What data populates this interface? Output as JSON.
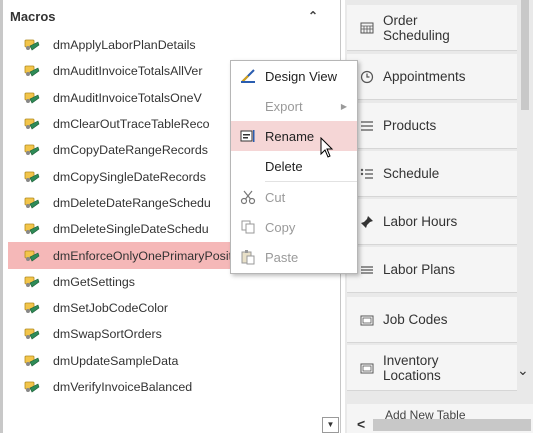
{
  "nav": {
    "header": "Macros",
    "macros": [
      "dmApplyLaborPlanDetails",
      "dmAuditInvoiceTotalsAllVer",
      "dmAuditInvoiceTotalsOneV",
      "dmClearOutTraceTableReco",
      "dmCopyDateRangeRecords",
      "dmCopySingleDateRecords",
      "dmDeleteDateRangeSchedu",
      "dmDeleteSingleDateSchedu",
      "dmEnforceOnlyOnePrimaryPosition",
      "dmGetSettings",
      "dmSetJobCodeColor",
      "dmSwapSortOrders",
      "dmUpdateSampleData",
      "dmVerifyInvoiceBalanced"
    ],
    "selected_index": 8
  },
  "context_menu": {
    "items": [
      {
        "label": "Design View",
        "icon": "design-view-icon",
        "enabled": true
      },
      {
        "label": "Export",
        "icon": "",
        "enabled": false,
        "submenu": true
      },
      {
        "label": "Rename",
        "icon": "rename-icon",
        "enabled": true,
        "hovered": true
      },
      {
        "label": "Delete",
        "icon": "",
        "enabled": true
      },
      {
        "label": "Cut",
        "icon": "scissors-icon",
        "enabled": false
      },
      {
        "label": "Copy",
        "icon": "copy-icon",
        "enabled": false
      },
      {
        "label": "Paste",
        "icon": "paste-icon",
        "enabled": false
      }
    ]
  },
  "right_pane": {
    "buttons": [
      {
        "label": "Order Scheduling",
        "icon": "calendar-grid-icon"
      },
      {
        "label": "Appointments",
        "icon": "clock-icon"
      },
      {
        "label": "Products",
        "icon": "list-icon"
      },
      {
        "label": "Schedule",
        "icon": "schedule-list-icon"
      },
      {
        "label": "Labor Hours",
        "icon": "pin-icon"
      },
      {
        "label": "Labor Plans",
        "icon": "lines-icon"
      },
      {
        "label": "Job Codes",
        "icon": "folder-icon"
      },
      {
        "label": "Inventory Locations",
        "icon": "folder-icon"
      }
    ],
    "bottom_text": "Add New Table"
  },
  "colors": {
    "selected_row": "#f5b8b8",
    "menu_hover": "#f5d6d6",
    "pane_background": "#e9e9e9"
  }
}
